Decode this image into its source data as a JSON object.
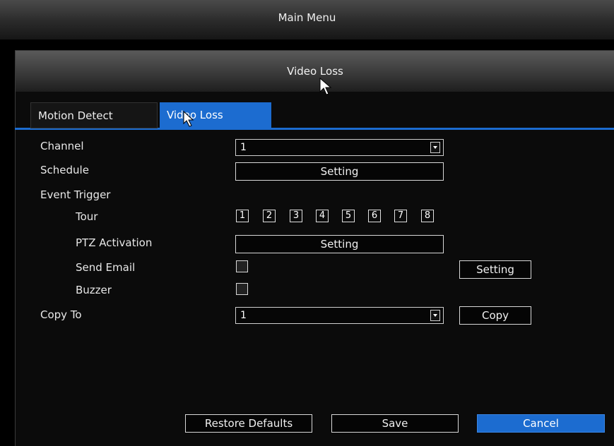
{
  "main_menu_title": "Main Menu",
  "panel_title": "Video Loss",
  "tabs": [
    {
      "label": "Motion Detect",
      "active": false
    },
    {
      "label": "Video Loss",
      "active": true
    }
  ],
  "form": {
    "channel_label": "Channel",
    "channel_value": "1",
    "schedule_label": "Schedule",
    "schedule_button": "Setting",
    "event_trigger_label": "Event Trigger",
    "tour_label": "Tour",
    "tour_channels": [
      "1",
      "2",
      "3",
      "4",
      "5",
      "6",
      "7",
      "8"
    ],
    "ptz_label": "PTZ Activation",
    "ptz_button": "Setting",
    "send_email_label": "Send Email",
    "send_email_checked": false,
    "send_email_button": "Setting",
    "buzzer_label": "Buzzer",
    "buzzer_checked": false,
    "copy_to_label": "Copy To",
    "copy_to_value": "1",
    "copy_button": "Copy"
  },
  "footer": {
    "restore_defaults": "Restore Defaults",
    "save": "Save",
    "cancel": "Cancel"
  },
  "colors": {
    "accent": "#1c6cd0",
    "background": "#0b0b0b"
  }
}
